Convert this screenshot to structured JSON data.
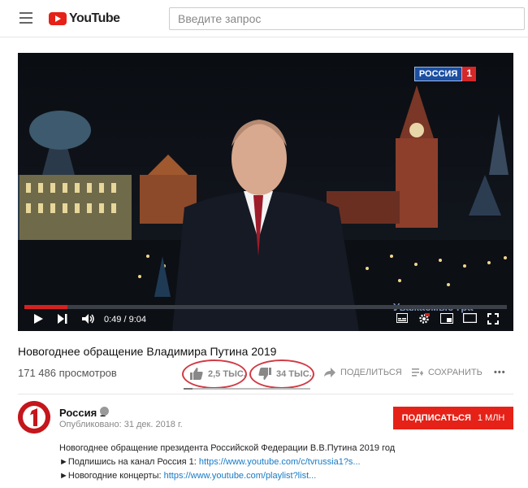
{
  "header": {
    "logo_text": "YouTube",
    "search_placeholder": "Введите запрос"
  },
  "player": {
    "channel_logo": {
      "name": "РОССИЯ",
      "number": "1"
    },
    "subtitle_text": "Уважаемые гра",
    "current_time": "0:49",
    "duration": "9:04",
    "progress": 0.09,
    "buffered": 0.17
  },
  "video": {
    "title": "Новогоднее обращение Владимира Путина 2019",
    "views": "171 486 просмотров",
    "likes": "2,5 ТЫС.",
    "dislikes": "34 ТЫС.",
    "share_label": "ПОДЕЛИТЬСЯ",
    "save_label": "СОХРАНИТЬ",
    "more_label": "•••",
    "like_ratio": 0.07
  },
  "channel": {
    "name": "Россия 1",
    "published": "Опубликовано: 31 дек. 2018 г.",
    "subscribe_label": "ПОДПИСАТЬСЯ",
    "subscriber_count": "1 МЛН"
  },
  "description": {
    "line1": "Новогоднее обращение президента Российской Федерации В.В.Путина 2019 год",
    "line2_text": "►Подпишись на канал Россия 1: ",
    "line2_link": "https://www.youtube.com/c/tvrussia1?s...",
    "line3_text": "►Новогодние концерты: ",
    "line3_link": "https://www.youtube.com/playlist?list..."
  },
  "colors": {
    "brand_red": "#e62117",
    "annotation_ring": "#d03a45",
    "link": "#167ac6"
  }
}
